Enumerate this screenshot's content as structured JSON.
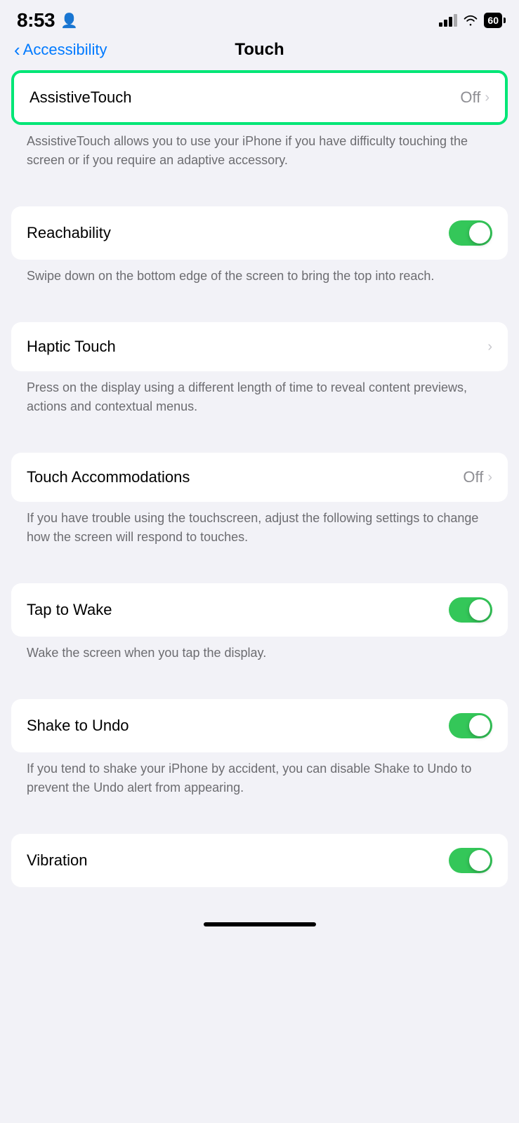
{
  "statusBar": {
    "time": "8:53",
    "battery": "60"
  },
  "header": {
    "backLabel": "Accessibility",
    "pageTitle": "Touch"
  },
  "sections": [
    {
      "id": "assistive-touch",
      "rows": [
        {
          "label": "AssistiveTouch",
          "rightText": "Off",
          "hasChevron": true,
          "toggleType": "none",
          "highlight": true
        }
      ],
      "description": "AssistiveTouch allows you to use your iPhone if you have difficulty touching the screen or if you require an adaptive accessory."
    },
    {
      "id": "reachability",
      "rows": [
        {
          "label": "Reachability",
          "rightText": "",
          "hasChevron": false,
          "toggleType": "on",
          "highlight": false
        }
      ],
      "description": "Swipe down on the bottom edge of the screen to bring the top into reach."
    },
    {
      "id": "haptic-touch",
      "rows": [
        {
          "label": "Haptic Touch",
          "rightText": "",
          "hasChevron": true,
          "toggleType": "none",
          "highlight": false
        }
      ],
      "description": "Press on the display using a different length of time to reveal content previews, actions and contextual menus."
    },
    {
      "id": "touch-accommodations",
      "rows": [
        {
          "label": "Touch Accommodations",
          "rightText": "Off",
          "hasChevron": true,
          "toggleType": "none",
          "highlight": false
        }
      ],
      "description": "If you have trouble using the touchscreen, adjust the following settings to change how the screen will respond to touches."
    },
    {
      "id": "tap-to-wake",
      "rows": [
        {
          "label": "Tap to Wake",
          "rightText": "",
          "hasChevron": false,
          "toggleType": "on",
          "highlight": false
        }
      ],
      "description": "Wake the screen when you tap the display."
    },
    {
      "id": "shake-to-undo",
      "rows": [
        {
          "label": "Shake to Undo",
          "rightText": "",
          "hasChevron": false,
          "toggleType": "on",
          "highlight": false
        }
      ],
      "description": "If you tend to shake your iPhone by accident, you can disable Shake to Undo to prevent the Undo alert from appearing."
    },
    {
      "id": "vibration",
      "rows": [
        {
          "label": "Vibration",
          "rightText": "",
          "hasChevron": false,
          "toggleType": "on",
          "highlight": false,
          "partial": true
        }
      ],
      "description": ""
    }
  ]
}
